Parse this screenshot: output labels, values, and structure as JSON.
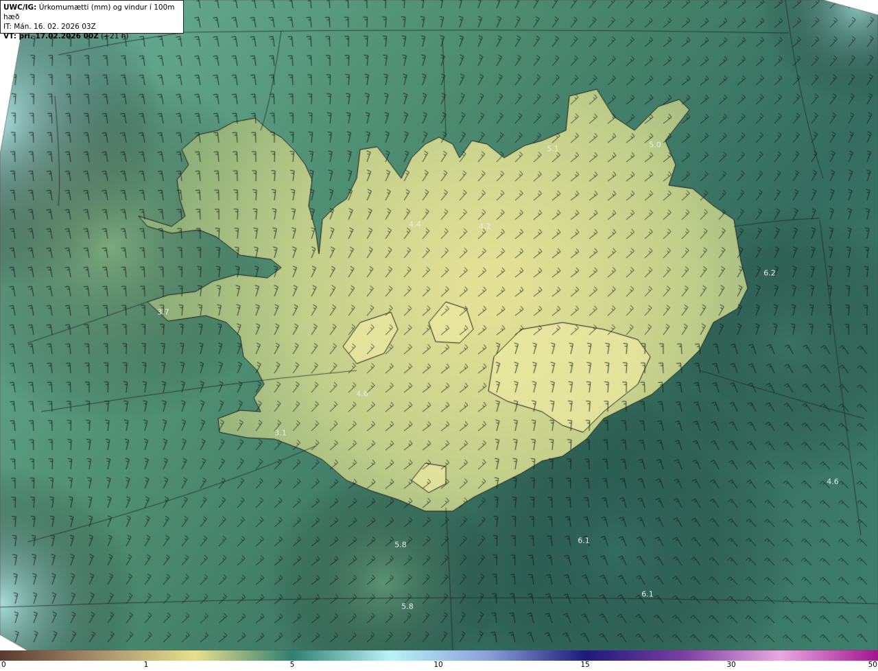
{
  "header": {
    "product": "UWC/IG:",
    "description": "Úrkomumætti (mm) og vindur í 100m hæð",
    "init_time": "IT: Mán. 16. 02. 2026 03Z",
    "valid_prefix": "VT: þri. 17.02.2026 00Z",
    "valid_suffix": "(+21 h)"
  },
  "map_labels": [
    {
      "text": "5.1"
    },
    {
      "text": "5.0"
    },
    {
      "text": "4.4"
    },
    {
      "text": "4.2"
    },
    {
      "text": "6.2"
    },
    {
      "text": "3.7"
    },
    {
      "text": "4.6"
    },
    {
      "text": "3.1"
    },
    {
      "text": "4.6"
    },
    {
      "text": "5.8"
    },
    {
      "text": "6.1"
    },
    {
      "text": "6.1"
    },
    {
      "text": "5.8"
    }
  ],
  "colorbar": {
    "ticks": [
      "0",
      "1",
      "5",
      "10",
      "15",
      "30",
      "50"
    ],
    "colors": [
      "#5a3a2e",
      "#a58f6c",
      "#e6e08e",
      "#2f7f6e",
      "#b9f3f6",
      "#8aa0d8",
      "#1b1b7a",
      "#7a3fa0",
      "#e9a9e0",
      "#a0148c"
    ]
  },
  "map_colors": {
    "sea_deep": "#356e60",
    "sea_shallow": "#4f8f72",
    "land_low": "#8fb07a",
    "land_high": "#e3e196",
    "edge_light": "#bdf2f4",
    "outline": "#1b1b1b"
  }
}
